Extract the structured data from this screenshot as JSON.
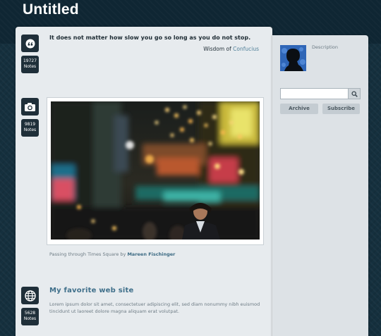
{
  "blog": {
    "title": "Untitled"
  },
  "posts": {
    "quote": {
      "icon": "quote-icon",
      "notes_count": "19727",
      "notes_label": "Notes",
      "text": "It does not matter how slow you go so long as you do not stop.",
      "source_prefix": "Wisdom of",
      "source_author": "Confucius"
    },
    "photo": {
      "icon": "camera-icon",
      "notes_count": "9819",
      "notes_label": "Notes",
      "caption_prefix": "Passing through Times Square by",
      "caption_credit": "Mareen Fischinger"
    },
    "link": {
      "icon": "globe-icon",
      "notes_count": "5628",
      "notes_label": "Notes",
      "title": "My favorite web site",
      "body": "Lorem ipsum dolor sit amet, consectetuer adipiscing elit, sed diam nonummy nibh euismod tincidunt ut laoreet dolore magna aliquam erat volutpat."
    }
  },
  "sidebar": {
    "description_label": "Description",
    "search": {
      "value": "",
      "placeholder": ""
    },
    "archive_label": "Archive",
    "subscribe_label": "Subscribe"
  },
  "colors": {
    "background": "#15303e",
    "panel": "#e7ebee",
    "sidebar": "#dde2e6",
    "icon_badge": "#1f2f39",
    "link_title": "#3f6f8a"
  }
}
